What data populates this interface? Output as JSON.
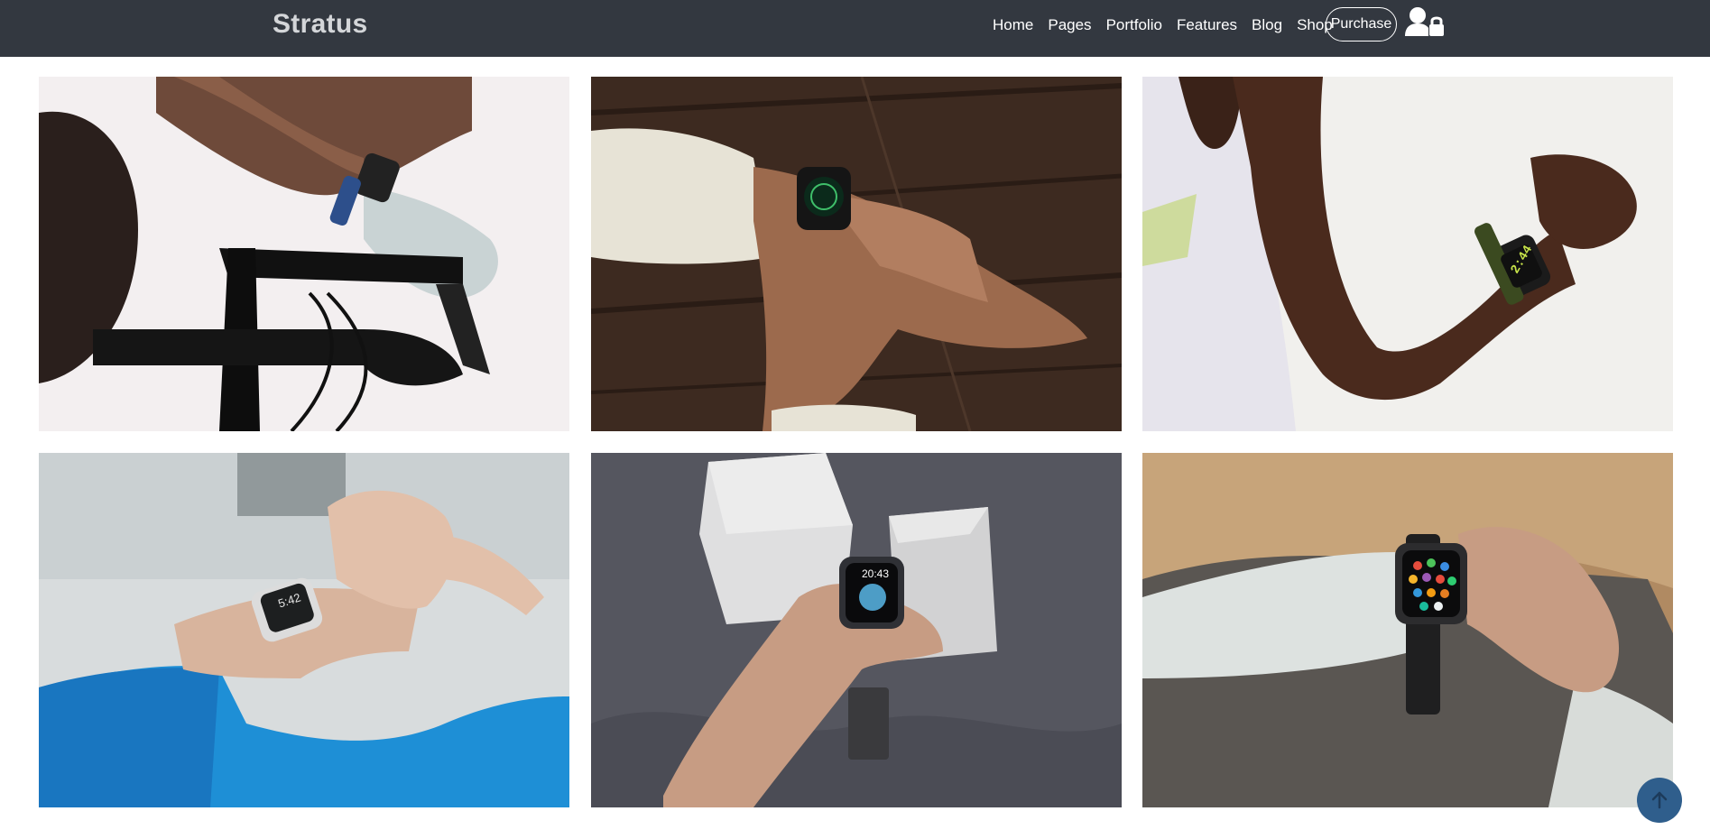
{
  "brand": "Stratus",
  "nav": {
    "items": [
      "Home",
      "Pages",
      "Portfolio",
      "Features",
      "Blog",
      "Shop"
    ],
    "purchase_label": "Purchase",
    "account_icon": "user-lock-icon"
  },
  "gallery": {
    "photos": [
      {
        "subject": "cyclist-wearing-smartwatch"
      },
      {
        "subject": "hand-on-wooden-table-with-smartwatch"
      },
      {
        "subject": "runner-arm-with-smartwatch"
      },
      {
        "subject": "checking-smartwatch-blue-sleeve"
      },
      {
        "subject": "holding-smartwatch-grey-background"
      },
      {
        "subject": "tapping-smartwatch-app-grid"
      }
    ]
  },
  "watch_screens": {
    "photo_5_time": "20:43",
    "photo_4_time": "5:42",
    "photo_3_display": "2:44"
  },
  "scroll_top_icon": "arrow-up-icon",
  "colors": {
    "navbar": "#333840",
    "brand_text": "#d4d6d9",
    "scroll_top": "#2f5e8c"
  }
}
